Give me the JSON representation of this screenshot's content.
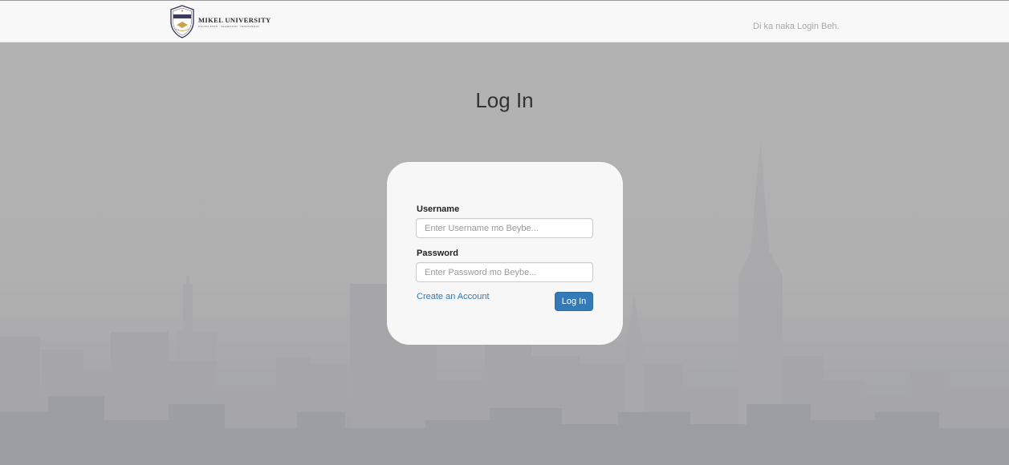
{
  "navbar": {
    "brand_name": "MIKEL UNIVERSITY",
    "brand_tagline": "EXCELLENCE · TRADITION · INNOVATION",
    "logo_icon": "university-crest-logo",
    "status_text": "Di ka naka Login Beh."
  },
  "page": {
    "title": "Log In"
  },
  "login_form": {
    "username_label": "Username",
    "username_placeholder": "Enter Username mo Beybe...",
    "username_value": "",
    "password_label": "Password",
    "password_placeholder": "Enter Password mo Beybe...",
    "password_value": "",
    "create_account_link": "Create an Account",
    "submit_label": "Log In"
  },
  "colors": {
    "navbar_bg": "#f8f8f8",
    "page_bg": "#b2b2b2",
    "card_bg": "#f7f7f7",
    "primary": "#337ab7",
    "link": "#337ab7"
  }
}
